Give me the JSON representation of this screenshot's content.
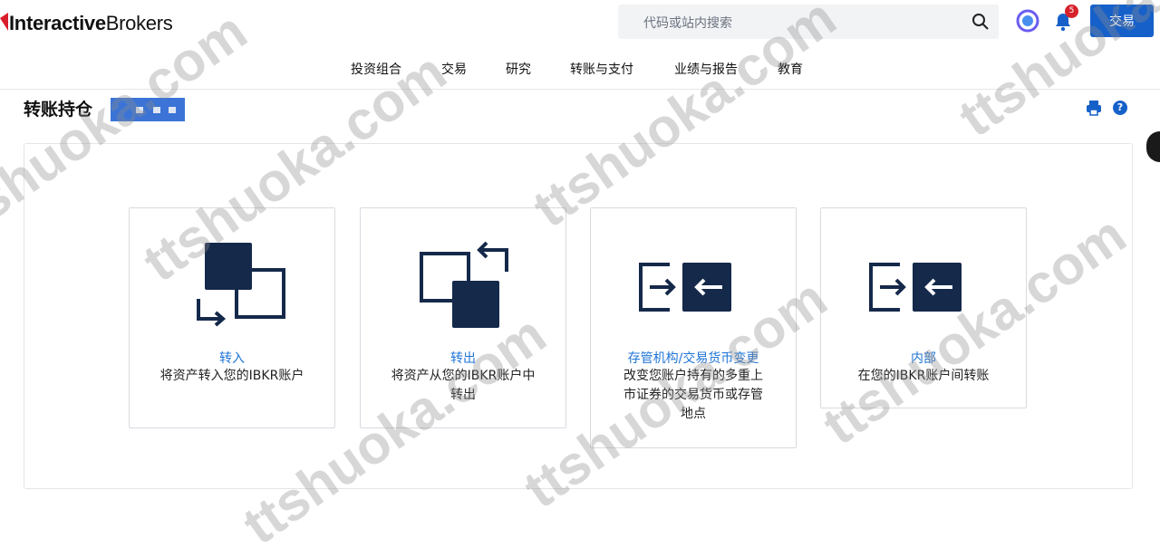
{
  "header": {
    "logo_bold": "Interactive",
    "logo_regular": "Brokers",
    "search_placeholder": "代码或站内搜索",
    "notification_count": "5",
    "trade_button": "交易"
  },
  "nav": {
    "items": [
      "投资组合",
      "交易",
      "研究",
      "转账与支付",
      "业绩与报告",
      "教育"
    ]
  },
  "page": {
    "title": "转账持仓"
  },
  "cards": [
    {
      "title": "转入",
      "desc": "将资产转入您的IBKR账户",
      "icon": "transfer-in-icon"
    },
    {
      "title": "转出",
      "desc": "将资产从您的IBKR账户中转出",
      "icon": "transfer-out-icon"
    },
    {
      "title": "存管机构/交易货币变更",
      "desc": "改变您账户持有的多重上市证券的交易货币或存管地点",
      "icon": "custodian-change-icon"
    },
    {
      "title": "内部",
      "desc": "在您的IBKR账户间转账",
      "icon": "internal-transfer-icon"
    }
  ],
  "watermark": "ttshuoka.com",
  "colors": {
    "brand_blue": "#1660c9",
    "link_blue": "#1f74d6",
    "icon_navy": "#15294a",
    "badge_red": "#d6212b"
  }
}
